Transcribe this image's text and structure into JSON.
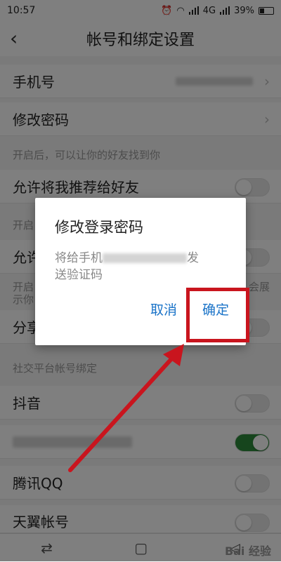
{
  "status": {
    "time": "10:57",
    "network": "4G",
    "battery": "39%"
  },
  "header": {
    "title": "帐号和绑定设置"
  },
  "list": {
    "phone_label": "手机号",
    "change_password_label": "修改密码",
    "section_hint": "开启后，可以让你的好友找到你",
    "recommend_label": "允许将我推荐给好友",
    "section_partial": "开启",
    "allow_partial": "允许",
    "section_long_partial_left": "开启",
    "section_long_partial_right": "会展",
    "section_long_partial_line2": "示你",
    "share_partial": "分享",
    "social_section": "社交平台帐号绑定",
    "douyin_label": "抖音",
    "qq_label": "腾讯QQ",
    "tianyi_label": "天翼帐号"
  },
  "dialog": {
    "title": "修改登录密码",
    "message_prefix": "将给手机",
    "message_suffix": "发",
    "message_line2": "送验证码",
    "cancel_label": "取消",
    "confirm_label": "确定"
  },
  "watermark": "Bai 经验",
  "colors": {
    "overlay": "rgba(0,0,0,0.5)",
    "link": "#1a73c8",
    "highlight": "#c9151e",
    "toggle_on": "#2c8a3a"
  }
}
